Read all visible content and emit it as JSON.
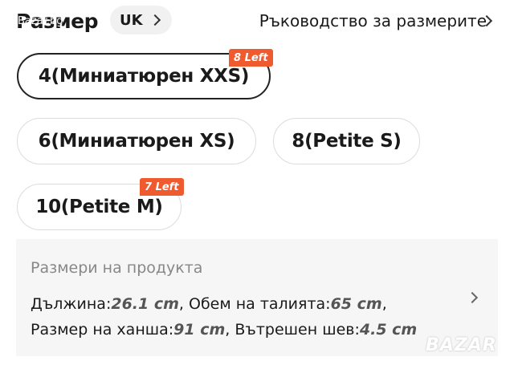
{
  "header": {
    "title": "Размер",
    "watermark_small": "Bazar.bg",
    "region": "UK",
    "size_guide": "Ръководство за размерите"
  },
  "sizes": [
    {
      "label": "4(Миниатюрен XXS)",
      "badge": "8 Left",
      "selected": true
    },
    {
      "label": "6(Миниатюрен XS)",
      "badge": "",
      "selected": false
    },
    {
      "label": "8(Petite S)",
      "badge": "",
      "selected": false
    },
    {
      "label": "10(Petite M)",
      "badge": "7 Left",
      "selected": false
    }
  ],
  "product_sizes": {
    "title": "Размери на продукта",
    "length_label": "Дължина:",
    "length_value": "26.1 cm",
    "waist_label": ", Обем на талията:",
    "waist_value": "65 cm",
    "waist_suffix": ",",
    "hip_label": "Размер на ханша:",
    "hip_value": "91 cm",
    "inseam_label": ", Вътрешен шев:",
    "inseam_value": "4.5 cm"
  },
  "watermark": "BAZAR",
  "colors": {
    "badge": "#ef5a2f",
    "selected_border": "#222222",
    "box_bg": "#f6f6f6"
  },
  "icons": [
    "chevron-right-icon"
  ]
}
